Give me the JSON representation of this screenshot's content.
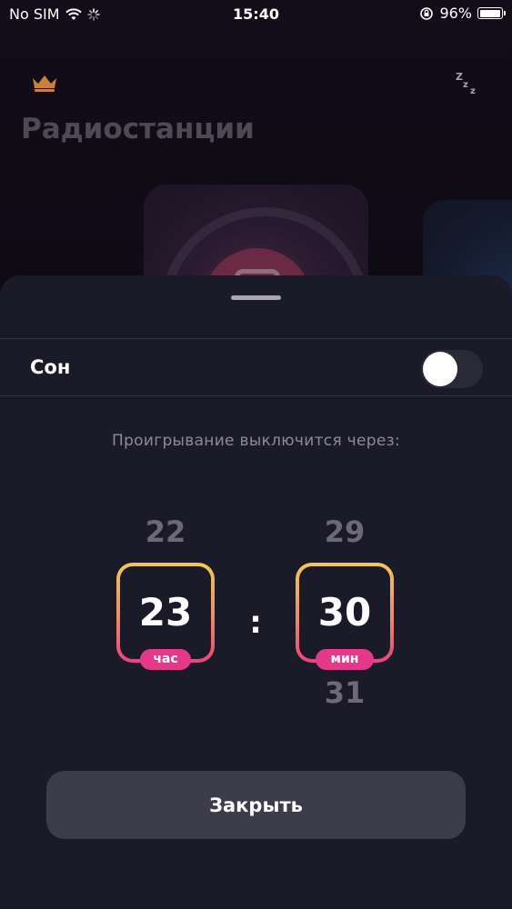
{
  "status_bar": {
    "carrier": "No SIM",
    "time": "15:40",
    "battery": "96%",
    "battery_level": 0.96
  },
  "header": {
    "title": "Радиостанции",
    "left_icon": "crown-icon",
    "right_icon": "sleep-zzz-icon"
  },
  "sheet": {
    "sleep_label": "Сон",
    "sleep_enabled": false,
    "hint": "Проигрывание выключится через:",
    "hours": {
      "prev": "22",
      "value": "23",
      "unit": "час"
    },
    "minutes": {
      "prev": "29",
      "value": "30",
      "next": "31",
      "unit": "мин"
    },
    "separator": ":",
    "close_label": "Закрыть"
  },
  "colors": {
    "sheet_bg": "#1b1a29",
    "accent_pink": "#e4388a",
    "accent_gold": "#f2c858",
    "crown": "#c9803a"
  }
}
